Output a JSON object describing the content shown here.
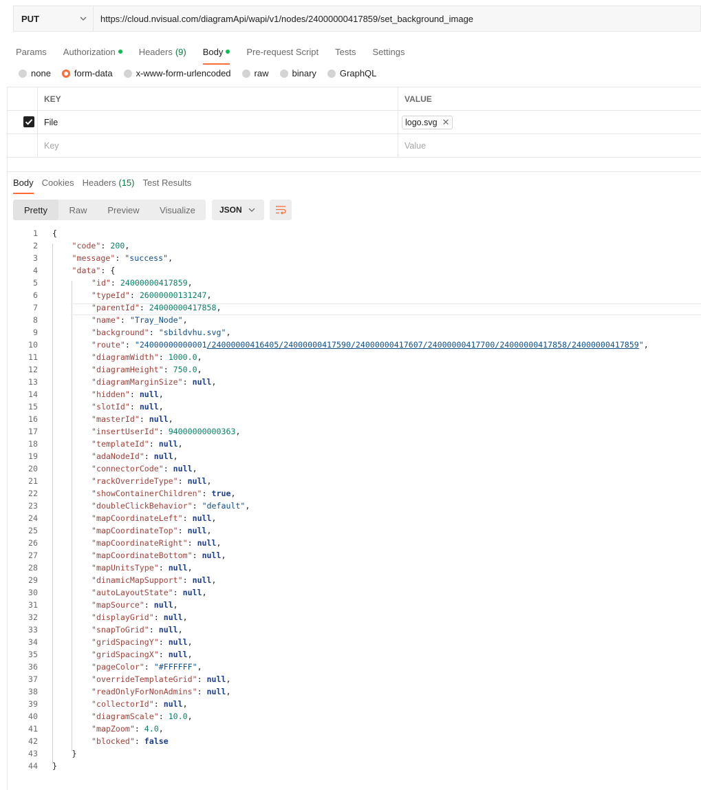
{
  "request": {
    "method": "PUT",
    "url": "https://cloud.nvisual.com/diagramApi/wapi/v1/nodes/24000000417859/set_background_image"
  },
  "request_tabs": [
    {
      "label": "Params"
    },
    {
      "label": "Authorization",
      "dot": true
    },
    {
      "label": "Headers",
      "count": "(9)"
    },
    {
      "label": "Body",
      "dot": true,
      "active": true
    },
    {
      "label": "Pre-request Script"
    },
    {
      "label": "Tests"
    },
    {
      "label": "Settings"
    }
  ],
  "body_types": [
    {
      "label": "none",
      "selected": false
    },
    {
      "label": "form-data",
      "selected": true
    },
    {
      "label": "x-www-form-urlencoded",
      "selected": false
    },
    {
      "label": "raw",
      "selected": false
    },
    {
      "label": "binary",
      "selected": false
    },
    {
      "label": "GraphQL",
      "selected": false
    }
  ],
  "form_table": {
    "key_header": "KEY",
    "value_header": "VALUE",
    "row": {
      "key": "File",
      "value": "logo.svg",
      "checked": true
    },
    "placeholder_key": "Key",
    "placeholder_value": "Value"
  },
  "response_tabs": [
    {
      "label": "Body",
      "active": true
    },
    {
      "label": "Cookies"
    },
    {
      "label": "Headers",
      "count": "(15)"
    },
    {
      "label": "Test Results"
    }
  ],
  "view_modes": [
    "Pretty",
    "Raw",
    "Preview",
    "Visualize"
  ],
  "active_view": "Pretty",
  "format": "JSON",
  "response_lines": [
    {
      "n": "1",
      "ind": 0,
      "t": [
        [
          "p",
          "{"
        ]
      ]
    },
    {
      "n": "2",
      "ind": 1,
      "t": [
        [
          "k",
          "\"code\""
        ],
        [
          "p",
          ": "
        ],
        [
          "n",
          "200"
        ],
        [
          "p",
          ","
        ]
      ]
    },
    {
      "n": "3",
      "ind": 1,
      "t": [
        [
          "k",
          "\"message\""
        ],
        [
          "p",
          ": "
        ],
        [
          "s",
          "\"success\""
        ],
        [
          "p",
          ","
        ]
      ]
    },
    {
      "n": "4",
      "ind": 1,
      "t": [
        [
          "k",
          "\"data\""
        ],
        [
          "p",
          ": "
        ],
        [
          "p",
          "{"
        ]
      ]
    },
    {
      "n": "5",
      "ind": 2,
      "t": [
        [
          "k",
          "\"id\""
        ],
        [
          "p",
          ": "
        ],
        [
          "n",
          "24000000417859"
        ],
        [
          "p",
          ","
        ]
      ]
    },
    {
      "n": "6",
      "ind": 2,
      "t": [
        [
          "k",
          "\"typeId\""
        ],
        [
          "p",
          ": "
        ],
        [
          "n",
          "26000000131247"
        ],
        [
          "p",
          ","
        ]
      ]
    },
    {
      "n": "7",
      "ind": 2,
      "t": [
        [
          "k",
          "\"parentId\""
        ],
        [
          "p",
          ": "
        ],
        [
          "n",
          "24000000417858"
        ],
        [
          "p",
          ","
        ]
      ]
    },
    {
      "n": "8",
      "ind": 2,
      "t": [
        [
          "k",
          "\"name\""
        ],
        [
          "p",
          ": "
        ],
        [
          "s",
          "\"Tray_Node\""
        ],
        [
          "p",
          ","
        ]
      ]
    },
    {
      "n": "9",
      "ind": 2,
      "t": [
        [
          "k",
          "\"background\""
        ],
        [
          "p",
          ": "
        ],
        [
          "s",
          "\"sbildvhu.svg\""
        ],
        [
          "p",
          ","
        ]
      ]
    },
    {
      "n": "10",
      "ind": 2,
      "t": [
        [
          "k",
          "\"route\""
        ],
        [
          "p",
          ": "
        ],
        [
          "s",
          "\"24000000000001"
        ],
        [
          "l",
          "/24000000416405/24000000417590/24000000417607/24000000417700/24000000417858/24000000417859"
        ],
        [
          "s",
          "\""
        ],
        [
          "p",
          ","
        ]
      ]
    },
    {
      "n": "11",
      "ind": 2,
      "t": [
        [
          "k",
          "\"diagramWidth\""
        ],
        [
          "p",
          ": "
        ],
        [
          "n",
          "1000.0"
        ],
        [
          "p",
          ","
        ]
      ]
    },
    {
      "n": "12",
      "ind": 2,
      "t": [
        [
          "k",
          "\"diagramHeight\""
        ],
        [
          "p",
          ": "
        ],
        [
          "n",
          "750.0"
        ],
        [
          "p",
          ","
        ]
      ]
    },
    {
      "n": "13",
      "ind": 2,
      "t": [
        [
          "k",
          "\"diagramMarginSize\""
        ],
        [
          "p",
          ": "
        ],
        [
          "kw",
          "null"
        ],
        [
          "p",
          ","
        ]
      ]
    },
    {
      "n": "14",
      "ind": 2,
      "t": [
        [
          "k",
          "\"hidden\""
        ],
        [
          "p",
          ": "
        ],
        [
          "kw",
          "null"
        ],
        [
          "p",
          ","
        ]
      ]
    },
    {
      "n": "15",
      "ind": 2,
      "t": [
        [
          "k",
          "\"slotId\""
        ],
        [
          "p",
          ": "
        ],
        [
          "kw",
          "null"
        ],
        [
          "p",
          ","
        ]
      ]
    },
    {
      "n": "16",
      "ind": 2,
      "t": [
        [
          "k",
          "\"masterId\""
        ],
        [
          "p",
          ": "
        ],
        [
          "kw",
          "null"
        ],
        [
          "p",
          ","
        ]
      ]
    },
    {
      "n": "17",
      "ind": 2,
      "t": [
        [
          "k",
          "\"insertUserId\""
        ],
        [
          "p",
          ": "
        ],
        [
          "n",
          "94000000000363"
        ],
        [
          "p",
          ","
        ]
      ]
    },
    {
      "n": "18",
      "ind": 2,
      "t": [
        [
          "k",
          "\"templateId\""
        ],
        [
          "p",
          ": "
        ],
        [
          "kw",
          "null"
        ],
        [
          "p",
          ","
        ]
      ]
    },
    {
      "n": "19",
      "ind": 2,
      "t": [
        [
          "k",
          "\"adaNodeId\""
        ],
        [
          "p",
          ": "
        ],
        [
          "kw",
          "null"
        ],
        [
          "p",
          ","
        ]
      ]
    },
    {
      "n": "20",
      "ind": 2,
      "t": [
        [
          "k",
          "\"connectorCode\""
        ],
        [
          "p",
          ": "
        ],
        [
          "kw",
          "null"
        ],
        [
          "p",
          ","
        ]
      ]
    },
    {
      "n": "21",
      "ind": 2,
      "t": [
        [
          "k",
          "\"rackOverrideType\""
        ],
        [
          "p",
          ": "
        ],
        [
          "kw",
          "null"
        ],
        [
          "p",
          ","
        ]
      ]
    },
    {
      "n": "22",
      "ind": 2,
      "t": [
        [
          "k",
          "\"showContainerChildren\""
        ],
        [
          "p",
          ": "
        ],
        [
          "kw",
          "true"
        ],
        [
          "p",
          ","
        ]
      ]
    },
    {
      "n": "23",
      "ind": 2,
      "t": [
        [
          "k",
          "\"doubleClickBehavior\""
        ],
        [
          "p",
          ": "
        ],
        [
          "s",
          "\"default\""
        ],
        [
          "p",
          ","
        ]
      ]
    },
    {
      "n": "24",
      "ind": 2,
      "t": [
        [
          "k",
          "\"mapCoordinateLeft\""
        ],
        [
          "p",
          ": "
        ],
        [
          "kw",
          "null"
        ],
        [
          "p",
          ","
        ]
      ]
    },
    {
      "n": "25",
      "ind": 2,
      "t": [
        [
          "k",
          "\"mapCoordinateTop\""
        ],
        [
          "p",
          ": "
        ],
        [
          "kw",
          "null"
        ],
        [
          "p",
          ","
        ]
      ]
    },
    {
      "n": "26",
      "ind": 2,
      "t": [
        [
          "k",
          "\"mapCoordinateRight\""
        ],
        [
          "p",
          ": "
        ],
        [
          "kw",
          "null"
        ],
        [
          "p",
          ","
        ]
      ]
    },
    {
      "n": "27",
      "ind": 2,
      "t": [
        [
          "k",
          "\"mapCoordinateBottom\""
        ],
        [
          "p",
          ": "
        ],
        [
          "kw",
          "null"
        ],
        [
          "p",
          ","
        ]
      ]
    },
    {
      "n": "28",
      "ind": 2,
      "t": [
        [
          "k",
          "\"mapUnitsType\""
        ],
        [
          "p",
          ": "
        ],
        [
          "kw",
          "null"
        ],
        [
          "p",
          ","
        ]
      ]
    },
    {
      "n": "29",
      "ind": 2,
      "t": [
        [
          "k",
          "\"dinamicMapSupport\""
        ],
        [
          "p",
          ": "
        ],
        [
          "kw",
          "null"
        ],
        [
          "p",
          ","
        ]
      ]
    },
    {
      "n": "30",
      "ind": 2,
      "t": [
        [
          "k",
          "\"autoLayoutState\""
        ],
        [
          "p",
          ": "
        ],
        [
          "kw",
          "null"
        ],
        [
          "p",
          ","
        ]
      ]
    },
    {
      "n": "31",
      "ind": 2,
      "t": [
        [
          "k",
          "\"mapSource\""
        ],
        [
          "p",
          ": "
        ],
        [
          "kw",
          "null"
        ],
        [
          "p",
          ","
        ]
      ]
    },
    {
      "n": "32",
      "ind": 2,
      "t": [
        [
          "k",
          "\"displayGrid\""
        ],
        [
          "p",
          ": "
        ],
        [
          "kw",
          "null"
        ],
        [
          "p",
          ","
        ]
      ]
    },
    {
      "n": "33",
      "ind": 2,
      "t": [
        [
          "k",
          "\"snapToGrid\""
        ],
        [
          "p",
          ": "
        ],
        [
          "kw",
          "null"
        ],
        [
          "p",
          ","
        ]
      ]
    },
    {
      "n": "34",
      "ind": 2,
      "t": [
        [
          "k",
          "\"gridSpacingY\""
        ],
        [
          "p",
          ": "
        ],
        [
          "kw",
          "null"
        ],
        [
          "p",
          ","
        ]
      ]
    },
    {
      "n": "35",
      "ind": 2,
      "t": [
        [
          "k",
          "\"gridSpacingX\""
        ],
        [
          "p",
          ": "
        ],
        [
          "kw",
          "null"
        ],
        [
          "p",
          ","
        ]
      ]
    },
    {
      "n": "36",
      "ind": 2,
      "t": [
        [
          "k",
          "\"pageColor\""
        ],
        [
          "p",
          ": "
        ],
        [
          "s",
          "\"#FFFFFF\""
        ],
        [
          "p",
          ","
        ]
      ]
    },
    {
      "n": "37",
      "ind": 2,
      "t": [
        [
          "k",
          "\"overrideTemplateGrid\""
        ],
        [
          "p",
          ": "
        ],
        [
          "kw",
          "null"
        ],
        [
          "p",
          ","
        ]
      ]
    },
    {
      "n": "38",
      "ind": 2,
      "t": [
        [
          "k",
          "\"readOnlyForNonAdmins\""
        ],
        [
          "p",
          ": "
        ],
        [
          "kw",
          "null"
        ],
        [
          "p",
          ","
        ]
      ]
    },
    {
      "n": "39",
      "ind": 2,
      "t": [
        [
          "k",
          "\"collectorId\""
        ],
        [
          "p",
          ": "
        ],
        [
          "kw",
          "null"
        ],
        [
          "p",
          ","
        ]
      ]
    },
    {
      "n": "40",
      "ind": 2,
      "t": [
        [
          "k",
          "\"diagramScale\""
        ],
        [
          "p",
          ": "
        ],
        [
          "n",
          "10.0"
        ],
        [
          "p",
          ","
        ]
      ]
    },
    {
      "n": "41",
      "ind": 2,
      "t": [
        [
          "k",
          "\"mapZoom\""
        ],
        [
          "p",
          ": "
        ],
        [
          "n",
          "4.0"
        ],
        [
          "p",
          ","
        ]
      ]
    },
    {
      "n": "42",
      "ind": 2,
      "t": [
        [
          "k",
          "\"blocked\""
        ],
        [
          "p",
          ": "
        ],
        [
          "kw",
          "false"
        ]
      ]
    },
    {
      "n": "43",
      "ind": 1,
      "t": [
        [
          "p",
          "}"
        ]
      ]
    },
    {
      "n": "44",
      "ind": 0,
      "t": [
        [
          "p",
          "}"
        ]
      ]
    }
  ],
  "colors": {
    "accent": "#ff6c37",
    "status_dot": "#0cbb52"
  }
}
